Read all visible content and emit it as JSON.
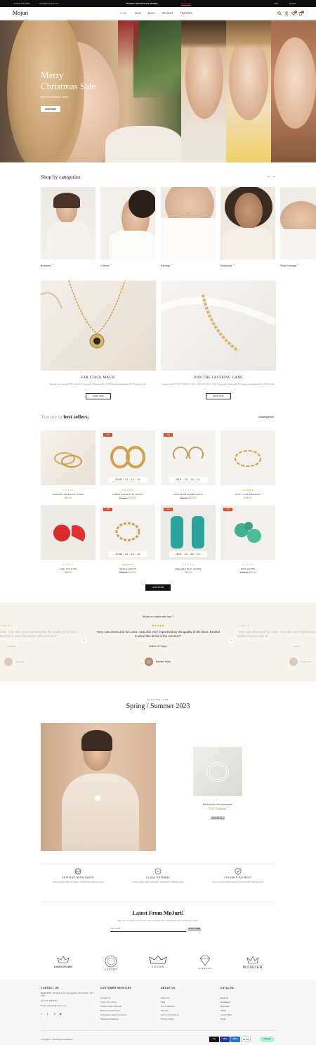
{
  "topbar": {
    "phone": "+1 (801) 555-6066",
    "email": "sales@example.com",
    "promo": "Summer sale discount off 50%!",
    "promo_link": "Shop Now",
    "currency": "USD",
    "language": "English"
  },
  "header": {
    "logo": "Mojuri",
    "nav": [
      "HOME",
      "SHOP",
      "BLOG",
      "PRODUCT",
      "FEATURES"
    ],
    "wishlist_count": "0",
    "cart_count": "0"
  },
  "hero": {
    "title_line1": "Merry",
    "title_line2": "Christmas Sale",
    "subtitle": "50% off all jewelry cases",
    "button": "SHOP NOW"
  },
  "categories": {
    "title": "Shop by categories",
    "items": [
      {
        "label": "Bracelets",
        "count": "11"
      },
      {
        "label": "Charms",
        "count": "11"
      },
      {
        "label": "Earrings",
        "count": "11"
      },
      {
        "label": "Necklaces",
        "count": "11"
      },
      {
        "label": "Shop Earrings",
        "count": "11"
      }
    ]
  },
  "promos": [
    {
      "title": "EAR STACK MAGIC",
      "desc": "Elevate your ear cuffs with a layout of lobe and mid-level studs in brilliant sole-mainstones. The choice is yours.",
      "button": "SHOP NOW"
    },
    {
      "title": "JOIN THE LAYERING GANG",
      "desc": "Love to stack? At first? Transform your outfits from day to night in new ensembles with the power of a necklace layer worth trends.",
      "button": "SHOP NOW"
    }
  ],
  "bestsellers": {
    "title_prefix": "You are in",
    "title_bold": "best sellers",
    "filter": "Uncategorized",
    "load_more": "LOAD MORE",
    "products": [
      {
        "name": "DIAMOND CELESTIAL STACK",
        "price": "$90.00",
        "old_price": "",
        "sale": "",
        "timer": "",
        "rating": 0
      },
      {
        "name": "LARGE CHARLOTTE HOOPS",
        "price": "$179.00",
        "old_price": "$200.00",
        "sale": "-5%",
        "timer": "129D : 12 : 12 : 10",
        "rating": 5
      },
      {
        "name": "CROISSANT DOME HOOPS",
        "price": "$300.00",
        "old_price": "$600.00",
        "sale": "-5%",
        "timer": "61D : 12 : 12 : 10",
        "rating": 0
      },
      {
        "name": "DAISY CLUB BRACELET",
        "price": "$185.00",
        "old_price": "",
        "sale": "",
        "timer": "",
        "rating": 5
      },
      {
        "name": "CHILI CUT RING",
        "price": "$95.00",
        "old_price": "",
        "sale": "",
        "timer": "",
        "rating": 0
      },
      {
        "name": "OPAL & HOOPS",
        "price": "$160.00",
        "old_price": "$200.00",
        "sale": "-5%",
        "timer": "108D : 12 : 12 : 10",
        "rating": 5
      },
      {
        "name": "REGULAR PLAY HOOPS",
        "price": "$80.00",
        "old_price": "",
        "sale": "-5%",
        "timer": "52D : 12 : 12 : 10",
        "rating": 0
      },
      {
        "name": "TWIN HOOPS",
        "price": "$60.00",
        "old_price": "$100.00",
        "sale": "-5%",
        "timer": "",
        "rating": 0
      }
    ]
  },
  "testimonials": {
    "title": "What our customers say ?",
    "quote": "“Very cute dress and fun color. I am also very impressed by the quality of the linen. Excited to wear this dress in the summer!”",
    "headline": "Makes me happy",
    "author": "Rachael Teodo",
    "side_left_quote": "color. I am also very impressed by the quality of the linen. Excited to wear this dress in the summer!”",
    "side_left_author": "Jess Doe",
    "side_left_headline": "Glow life",
    "side_right_quote": "“Very cute dress and fun color. I am also very impressed by the quality of the linen. Excited to wear this dr",
    "side_right_author": "Emilia Pase",
    "side_right_headline": "I love it"
  },
  "spring": {
    "kicker": "SHOP THE LOOK",
    "title": "Spring / Summer 2023",
    "product_name": "BOLD PEARL HOOP EARRINGS",
    "product_price": "$100.00",
    "product_old_price": "$150.00",
    "product_link": "VIEW DETAILS"
  },
  "features": [
    {
      "title": "SHIPPING WORLDWIDE",
      "desc": "Lorem ipsum dolor sit amet, consectetur adipiscing elit",
      "icon": "globe-icon"
    },
    {
      "title": "14 DAY RETURNS",
      "desc": "Lorem ipsum dolor sit amet, consectetur adipiscing elit",
      "icon": "return-icon"
    },
    {
      "title": "FLEXIBLE PAYMENT",
      "desc": "Lorem ipsum dolor sit amet, consectetur adipiscing elit",
      "icon": "shield-icon"
    }
  ],
  "newsletter": {
    "title": "Latest From MoJuri!",
    "desc": "Sign up to receive 10% off your next purchase. Plus hear about new arrivals and offers.",
    "placeholder": "Your email",
    "button": "SUBSCRIBE"
  },
  "brands": [
    "KINGCROWN",
    "LUXURY",
    "CROWN",
    "DIAMOND",
    "WONDER"
  ],
  "footer": {
    "col1_title": "CONTACT US",
    "address": "Head Office: 26 Wyle Cop, Shrewsbury, Shropshire, SY1 1XD",
    "tel": "Tel: 071 4223245",
    "email": "Email: support@mojuri.com",
    "col2_title": "CUSTOMER SERVICES",
    "col2": [
      "Contact Us",
      "Track Your Order",
      "Product Care & Repair",
      "Book an Appointment",
      "Frequently Asked Questions",
      "Shipping & Returns"
    ],
    "col3_title": "ABOUT US",
    "col3": [
      "About Us",
      "FAQ",
      "Our Producers",
      "Sitemap",
      "Terms & Conditions",
      "Privacy Policy"
    ],
    "col4_title": "CATALOG",
    "col4": [
      "Earrings",
      "Necklaces",
      "Bracelets",
      "Rings",
      "Jewelry Box",
      "Studs"
    ],
    "copyright": "Copyright © 2023 Mojuri Jewellery",
    "payments": [
      "Pay",
      "VISA",
      "AMEX",
      "PayPal",
      "clearpay"
    ]
  },
  "colors": {
    "accent": "#c0743a",
    "sale": "#d9522c",
    "dark": "#0e0e0e",
    "cream": "#f7f4ee"
  }
}
